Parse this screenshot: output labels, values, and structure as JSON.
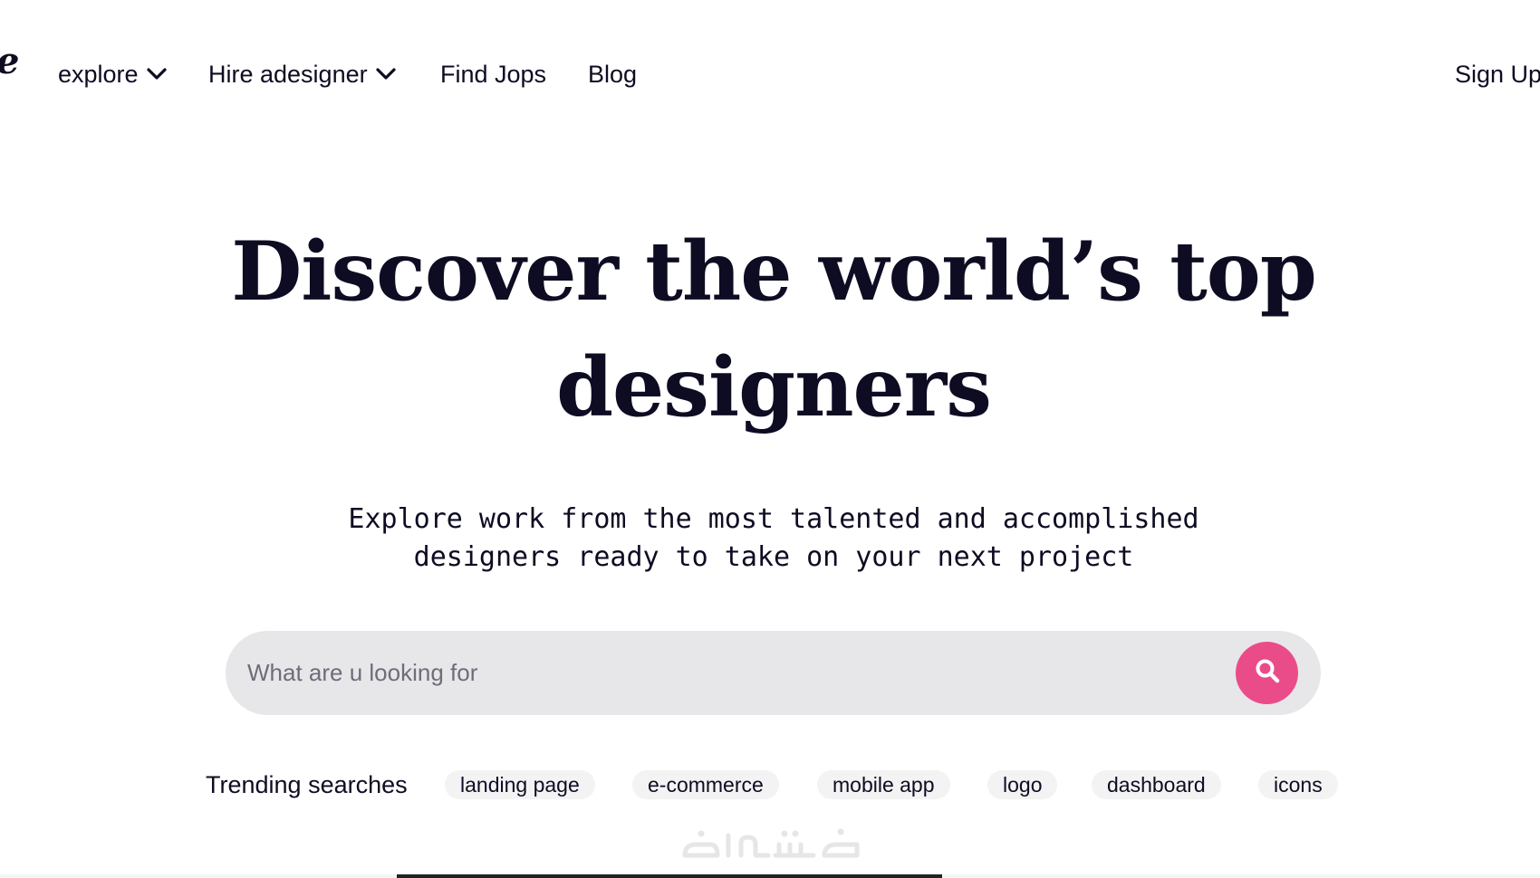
{
  "nav": {
    "logo_fragment": "e",
    "explore_label": "explore",
    "hire_label": "Hire adesigner",
    "jobs_label": "Find Jops",
    "blog_label": "Blog",
    "signup_label": "Sign Up"
  },
  "hero": {
    "title_line1": "Discover the world’s top",
    "title_line2": "designers",
    "subtitle_line1": "Explore work from the most talented and accomplished",
    "subtitle_line2": "designers ready to take on your next project"
  },
  "search": {
    "placeholder": "What are u looking for",
    "value": ""
  },
  "trending": {
    "label": "Trending searches",
    "tags": [
      "landing page",
      "e-commerce",
      "mobile app",
      "logo",
      "dashboard",
      "icons"
    ]
  },
  "colors": {
    "accent": "#ea4c89",
    "search_bg": "#e7e7e9",
    "tag_bg": "#f3f3f4",
    "text": "#0d0c22"
  },
  "icons": {
    "dropdown": "chevron-down-icon",
    "search": "search-icon"
  }
}
